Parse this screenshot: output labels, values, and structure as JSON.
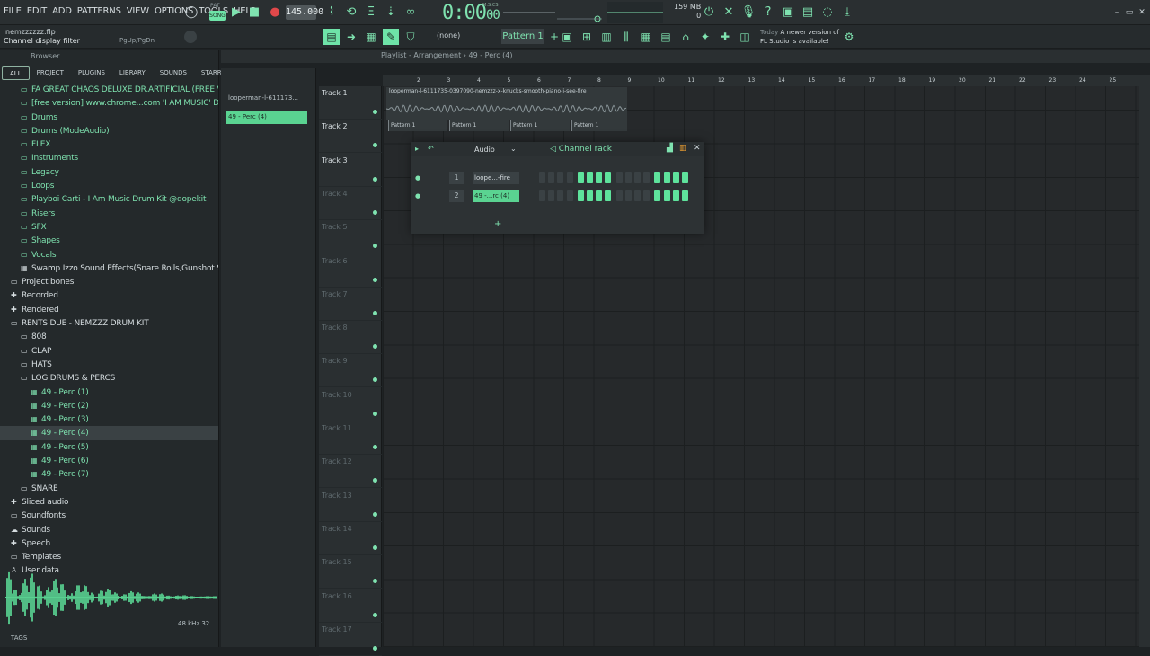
{
  "menu": [
    "FILE",
    "EDIT",
    "ADD",
    "PATTERNS",
    "VIEW",
    "OPTIONS",
    "TOOLS",
    "HELP"
  ],
  "transport": {
    "pat_label": "PAT",
    "song_label": "SONG",
    "tempo": "145.000",
    "time": "0:00",
    "time_ms": "00",
    "time_sub": "M:S:CS",
    "mem_top": "159 MB",
    "mem_bottom": "0"
  },
  "toolbar2": {
    "file_name": "nemzzzzzz.flp",
    "hint": "Channel display filter",
    "pgup": "PgUp/PgDn",
    "pattern_none": "(none)",
    "pattern": "Pattern 1",
    "news_today": "Today",
    "news_text_1": "A newer version of",
    "news_text_2": "FL Studio is available!"
  },
  "browser": {
    "title": "Browser",
    "tabs": [
      "ALL",
      "PROJECT",
      "PLUGINS",
      "LIBRARY",
      "SOUNDS",
      "STARRED"
    ],
    "active_tab": "ALL",
    "items": [
      {
        "label": "FA GREAT CHAOS DELUXE DR.ARTIFICIAL (FREE VERSION)",
        "indent": 2,
        "icon": "folder",
        "color": "green"
      },
      {
        "label": "[free version] www.chrome...com 'I AM MUSIC' Drum Kit",
        "indent": 2,
        "icon": "folder",
        "color": "green"
      },
      {
        "label": "Drums",
        "indent": 2,
        "icon": "folder",
        "color": "green"
      },
      {
        "label": "Drums (ModeAudio)",
        "indent": 2,
        "icon": "folder",
        "color": "green"
      },
      {
        "label": "FLEX",
        "indent": 2,
        "icon": "folder",
        "color": "green"
      },
      {
        "label": "Instruments",
        "indent": 2,
        "icon": "folder",
        "color": "green"
      },
      {
        "label": "Legacy",
        "indent": 2,
        "icon": "folder",
        "color": "green"
      },
      {
        "label": "Loops",
        "indent": 2,
        "icon": "folder",
        "color": "green"
      },
      {
        "label": "Playboi Carti - I Am Music Drum Kit @dopekit",
        "indent": 2,
        "icon": "folder",
        "color": "green"
      },
      {
        "label": "Risers",
        "indent": 2,
        "icon": "folder",
        "color": "green"
      },
      {
        "label": "SFX",
        "indent": 2,
        "icon": "folder",
        "color": "green"
      },
      {
        "label": "Shapes",
        "indent": 2,
        "icon": "folder",
        "color": "green"
      },
      {
        "label": "Vocals",
        "indent": 2,
        "icon": "folder",
        "color": "green"
      },
      {
        "label": "Swamp Izzo Sound Effects(Snare Rolls,Gunshot SFX)",
        "indent": 2,
        "icon": "file",
        "color": "white"
      },
      {
        "label": "Project bones",
        "indent": 1,
        "icon": "folder",
        "color": "white"
      },
      {
        "label": "Recorded",
        "indent": 1,
        "icon": "plus",
        "color": "white"
      },
      {
        "label": "Rendered",
        "indent": 1,
        "icon": "plus",
        "color": "white"
      },
      {
        "label": "RENTS DUE - NEMZZZ DRUM KIT",
        "indent": 1,
        "icon": "folder",
        "color": "white"
      },
      {
        "label": "808",
        "indent": 2,
        "icon": "folder",
        "color": "white"
      },
      {
        "label": "CLAP",
        "indent": 2,
        "icon": "folder",
        "color": "white"
      },
      {
        "label": "HATS",
        "indent": 2,
        "icon": "folder",
        "color": "white"
      },
      {
        "label": "LOG DRUMS & PERCS",
        "indent": 2,
        "icon": "folder",
        "color": "white"
      },
      {
        "label": "49 - Perc (1)",
        "indent": 3,
        "icon": "file",
        "color": "green"
      },
      {
        "label": "49 - Perc (2)",
        "indent": 3,
        "icon": "file",
        "color": "green"
      },
      {
        "label": "49 - Perc (3)",
        "indent": 3,
        "icon": "file",
        "color": "green"
      },
      {
        "label": "49 - Perc (4)",
        "indent": 3,
        "icon": "file",
        "color": "green",
        "selected": true
      },
      {
        "label": "49 - Perc (5)",
        "indent": 3,
        "icon": "file",
        "color": "green"
      },
      {
        "label": "49 - Perc (6)",
        "indent": 3,
        "icon": "file",
        "color": "green"
      },
      {
        "label": "49 - Perc (7)",
        "indent": 3,
        "icon": "file",
        "color": "green"
      },
      {
        "label": "SNARE",
        "indent": 2,
        "icon": "folder",
        "color": "white"
      },
      {
        "label": "Sliced audio",
        "indent": 1,
        "icon": "plus",
        "color": "white"
      },
      {
        "label": "Soundfonts",
        "indent": 1,
        "icon": "folder",
        "color": "white"
      },
      {
        "label": "Sounds",
        "indent": 1,
        "icon": "cloud",
        "color": "white"
      },
      {
        "label": "Speech",
        "indent": 1,
        "icon": "plus",
        "color": "white"
      },
      {
        "label": "Templates",
        "indent": 1,
        "icon": "folder",
        "color": "white"
      },
      {
        "label": "User data",
        "indent": 1,
        "icon": "user",
        "color": "white"
      }
    ],
    "wave_info": "48 kHz 32",
    "tags": "TAGS"
  },
  "picker": {
    "items": [
      {
        "label": "looperman-l-611173..."
      },
      {
        "label": "49 - Perc (4)",
        "selected": true
      }
    ]
  },
  "playlist": {
    "title": "Playlist - Arrangement",
    "pattern_crumb": "49 - Perc (4)",
    "ruler": [
      "2",
      "3",
      "4",
      "5",
      "6",
      "7",
      "8",
      "9",
      "10",
      "11",
      "12",
      "13",
      "14",
      "15",
      "16",
      "17",
      "18",
      "19",
      "20",
      "21",
      "22",
      "23",
      "24",
      "25"
    ],
    "tracks": [
      "Track 1",
      "Track 2",
      "Track 3",
      "Track 4",
      "Track 5",
      "Track 6",
      "Track 7",
      "Track 8",
      "Track 9",
      "Track 10",
      "Track 11",
      "Track 12",
      "Track 13",
      "Track 14",
      "Track 15",
      "Track 16",
      "Track 17"
    ],
    "active_tracks": 3,
    "audio_clip": "looperman-l-6111735-0397090-nemzzz-x-knucks-smooth-piano-i-see-fire",
    "pattern_clips": [
      "Pattern 1",
      "Pattern 1",
      "Pattern 1",
      "Pattern 1"
    ]
  },
  "channel_rack": {
    "filter": "Audio",
    "title": "Channel rack",
    "channels": [
      {
        "num": "1",
        "name": "loope...-fire",
        "steps": [
          0,
          0,
          0,
          0,
          1,
          1,
          1,
          1,
          0,
          0,
          0,
          0,
          1,
          1,
          1,
          1
        ],
        "selected": false
      },
      {
        "num": "2",
        "name": "49 -...rc (4)",
        "steps": [
          0,
          0,
          0,
          0,
          1,
          1,
          1,
          1,
          0,
          0,
          0,
          0,
          1,
          1,
          1,
          1
        ],
        "selected": true
      }
    ],
    "add": "+"
  },
  "colors": {
    "accent": "#7fe3b0",
    "accent_fill": "#5ee39c",
    "bg": "#1e2224"
  }
}
